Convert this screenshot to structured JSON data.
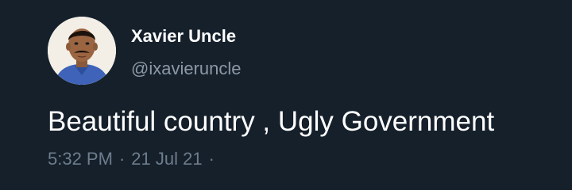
{
  "tweet": {
    "display_name": "Xavier Uncle",
    "handle": "@ixavieruncle",
    "text": "Beautiful country , Ugly Government",
    "time": "5:32 PM",
    "separator": "·",
    "date": "21 Jul 21",
    "trailing_separator": "·"
  },
  "colors": {
    "background": "#15202b",
    "primary_text": "#ffffff",
    "secondary_text": "#8b98a5"
  },
  "avatar": {
    "icon": "user-avatar-photo"
  }
}
